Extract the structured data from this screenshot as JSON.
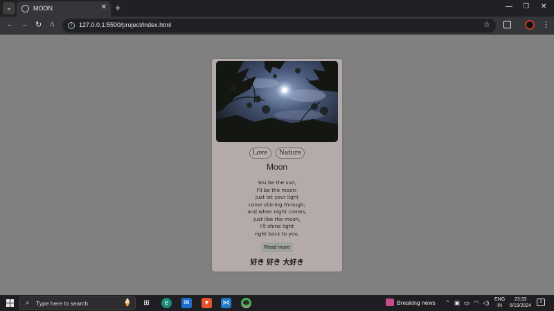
{
  "browser": {
    "tab_title": "MOON",
    "url": "127.0.0.1:5500/project/index.html"
  },
  "card": {
    "tags": [
      "Love",
      "Nature"
    ],
    "title": "Moon",
    "poem_lines": [
      "You be the sun,",
      "I'll be the moon-",
      "just let your light",
      "come shining through;",
      "and when night comes,",
      "just like the moon,",
      "I'll shine light",
      "right back to you."
    ],
    "read_more": "Read more",
    "japanese_text": "好き 好き 大好き"
  },
  "taskbar": {
    "search_placeholder": "Type here to search",
    "news_label": "Breaking news",
    "language": "ENG",
    "region": "IN",
    "time": "23:33",
    "date": "6/19/2024",
    "notification_count": "3"
  },
  "colors": {
    "page_background": "#808080",
    "card_background": "#b3aaa9",
    "read_more_button": "#9ea39e",
    "browser_chrome": "#35363a"
  }
}
